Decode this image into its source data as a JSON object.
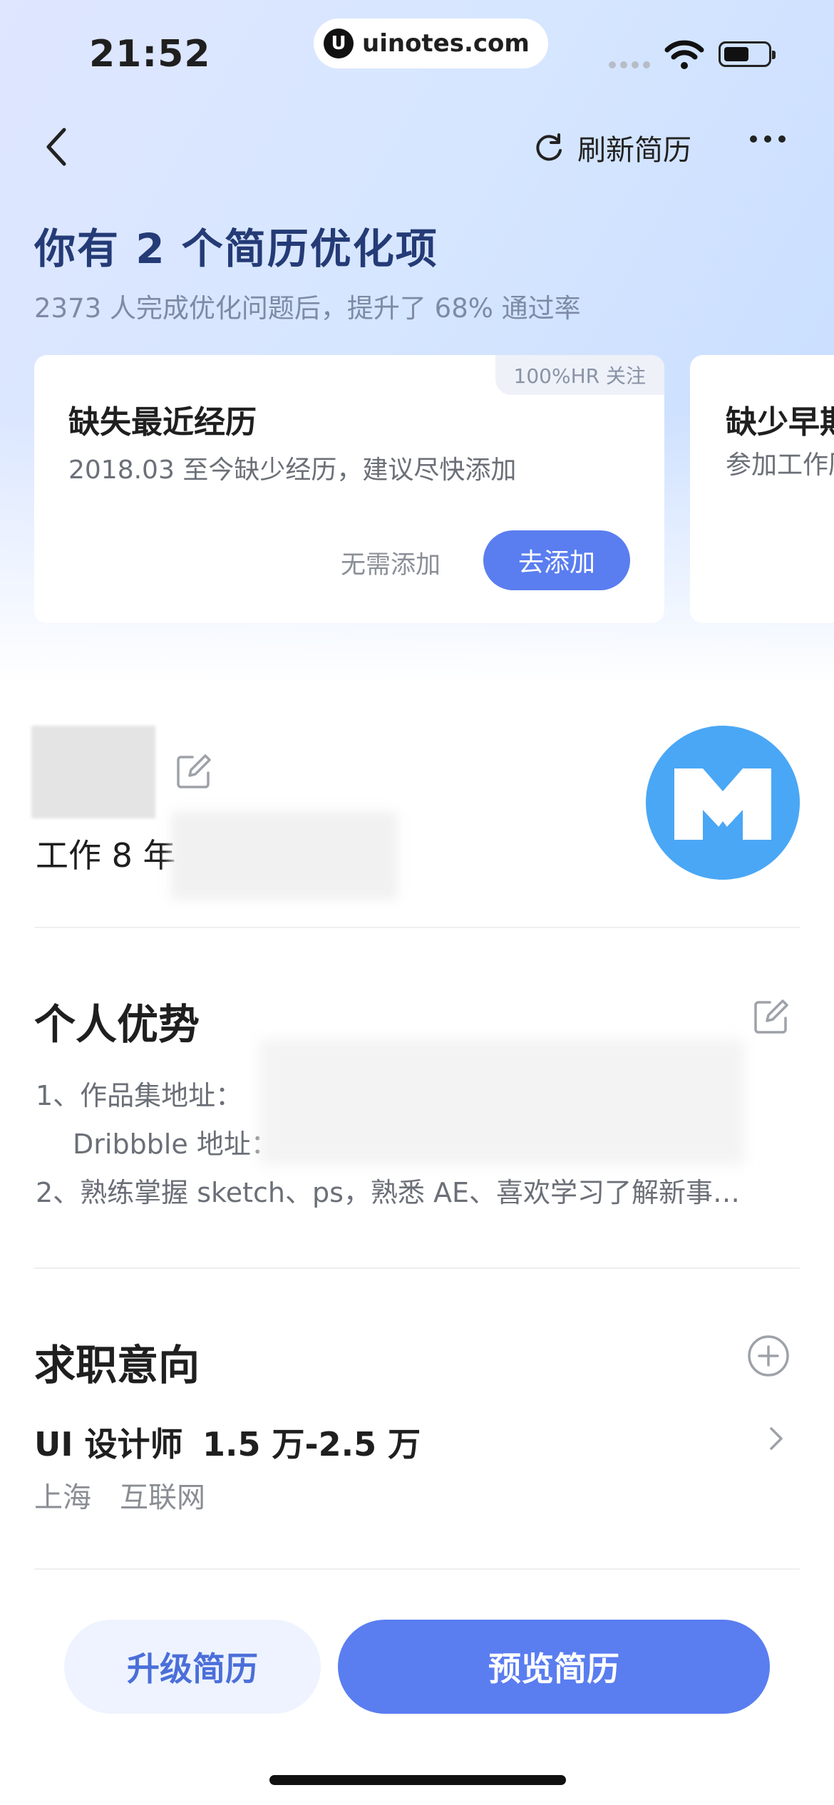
{
  "status_bar": {
    "time": "21:52",
    "watermark": "uinotes.com",
    "watermark_logo": "U"
  },
  "nav": {
    "refresh_label": "刷新简历"
  },
  "hero": {
    "title": "你有 2 个简历优化项",
    "subtitle": "2373 人完成优化问题后，提升了 68% 通过率"
  },
  "cards": [
    {
      "tag": "100%HR 关注",
      "title": "缺失最近经历",
      "desc": "2018.03 至今缺少经历，建议尽快添加",
      "skip_label": "无需添加",
      "add_label": "去添加"
    },
    {
      "title": "缺少早期",
      "desc": "参加工作历"
    }
  ],
  "profile": {
    "work_years": "工作 8 年"
  },
  "advantage": {
    "title": "个人优势",
    "lines": [
      "1、作品集地址：",
      "Dribbble 地址：",
      "2、熟练掌握 sketch、ps，熟悉 AE、喜欢学习了解新事…"
    ]
  },
  "intention": {
    "title": "求职意向",
    "job_title": "UI 设计师",
    "salary": "1.5 万-2.5 万",
    "city": "上海",
    "industry": "互联网"
  },
  "actions": {
    "upgrade_label": "升级简历",
    "preview_label": "预览简历"
  },
  "colors": {
    "accent": "#5a7df0",
    "title_blue": "#243b76",
    "avatar_blue": "#4aa7f5"
  }
}
